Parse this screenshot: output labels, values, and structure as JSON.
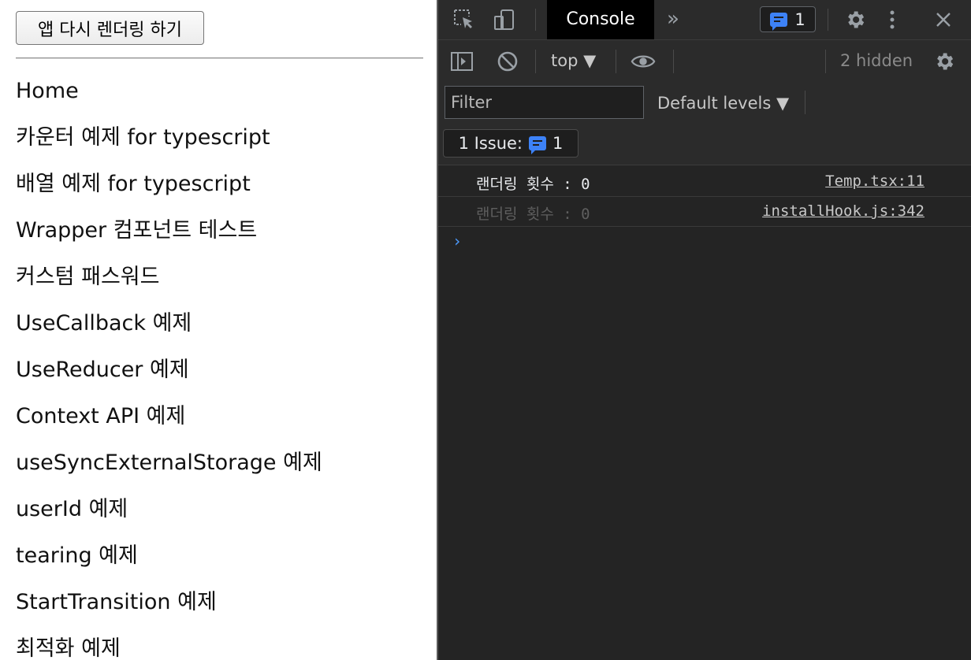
{
  "app": {
    "rerender_button": "앱 다시 렌더링 하기",
    "nav_items": [
      "Home",
      "카운터 예제 for typescript",
      "배열 예제 for typescript",
      "Wrapper 컴포넌트 테스트",
      "커스텀 패스워드",
      "UseCallback 예제",
      "UseReducer 예제",
      "Context API 예제",
      "useSyncExternalStorage 예제",
      "userId 예제",
      "tearing 예제",
      "StartTransition 예제",
      "최적화 예제"
    ]
  },
  "devtools": {
    "active_tab": "Console",
    "more_tabs_icon": "»",
    "issues_badge_count": "1",
    "context_select": "top ▼",
    "hidden_count": "2 hidden",
    "filter_placeholder": "Filter",
    "levels_select": "Default levels ▼",
    "issue_bar": {
      "label": "1 Issue:",
      "count": "1"
    },
    "logs": [
      {
        "message": "랜더링 횟수 : 0",
        "source": "Temp.tsx:11",
        "dimmed": false
      },
      {
        "message": "랜더링 횟수 : 0",
        "source": "installHook.js:342",
        "dimmed": true
      }
    ],
    "prompt": "›",
    "icons": [
      "inspect-icon",
      "device-toggle-icon",
      "chat-bubble-icon",
      "settings-icon",
      "kebab-menu-icon",
      "close-icon",
      "sidebar-toggle-icon",
      "clear-console-icon",
      "eye-icon"
    ],
    "colors": {
      "panel_bg": "#242424",
      "toolbar_bg": "#2b2b2b",
      "accent": "#3d82f7"
    }
  }
}
